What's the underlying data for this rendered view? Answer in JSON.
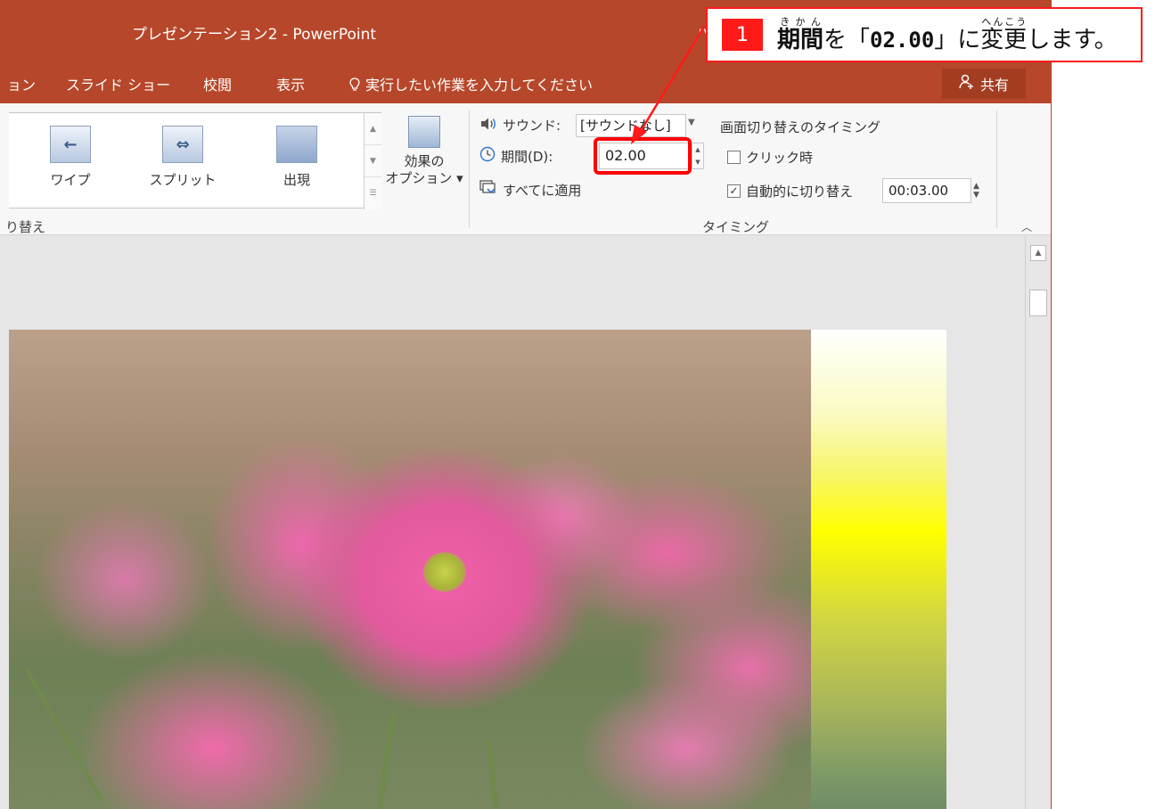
{
  "window": {
    "title": "プレゼンテーション2 - PowerPoint",
    "user_partial": "パ"
  },
  "tabs": [
    {
      "label": "ョン"
    },
    {
      "label": "スライド ショー"
    },
    {
      "label": "校閲"
    },
    {
      "label": "表示"
    }
  ],
  "tellme": {
    "placeholder": "実行したい作業を入力してください"
  },
  "share": {
    "label": "共有"
  },
  "gallery": {
    "items": [
      {
        "label": "ワイプ",
        "icon": "wipe-icon"
      },
      {
        "label": "スプリット",
        "icon": "split-icon"
      },
      {
        "label": "出現",
        "icon": "appear-icon"
      }
    ],
    "group_label": "り替え"
  },
  "effect_options": {
    "line1": "効果の",
    "line2": "オプション ▾"
  },
  "timing": {
    "sound_label": "サウンド:",
    "sound_value": "[サウンドなし]",
    "duration_label": "期間(D):",
    "duration_value": "02.00",
    "apply_all_label": "すべてに適用",
    "advance_title": "画面切り替えのタイミング",
    "on_click_label": "クリック時",
    "on_click_checked": false,
    "auto_label": "自動的に切り替え",
    "auto_checked": true,
    "auto_value": "00:03.00",
    "group_label": "タイミング"
  },
  "callout": {
    "number": "1",
    "word1": "期間",
    "word1_ruby": "きかん",
    "part2": "を「",
    "value": "02.00",
    "part3": "」に",
    "word2": "変更",
    "word2_ruby": "へんこう",
    "part4": "します。"
  },
  "colors": {
    "titlebar": "#b7472a",
    "callout_red": "#ff1a1a"
  }
}
